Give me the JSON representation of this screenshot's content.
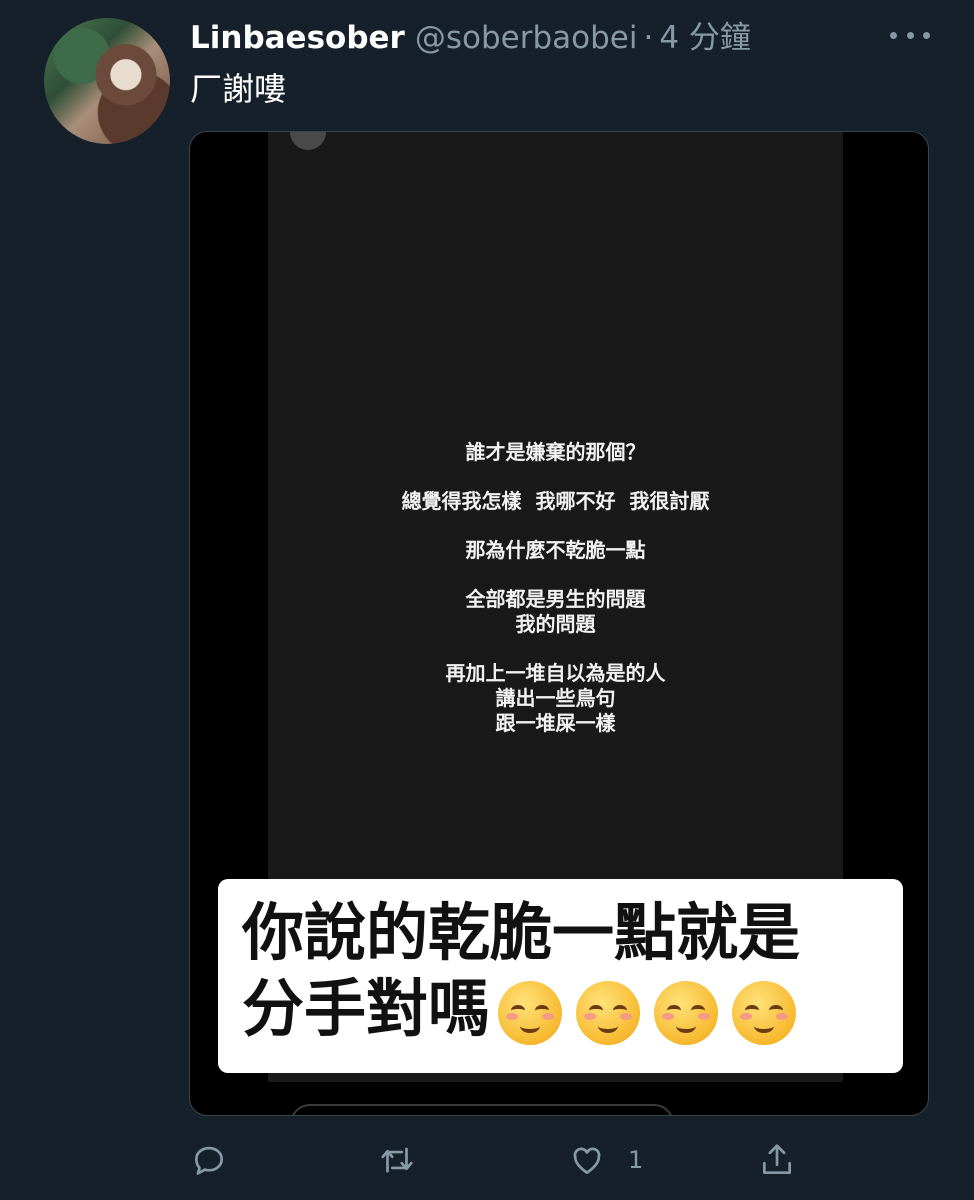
{
  "tweet": {
    "display_name": "Linbaesober",
    "handle": "@soberbaobei",
    "separator": "·",
    "time": "4 分鐘",
    "text": "厂謝嘍"
  },
  "media": {
    "story_lines": [
      "誰才是嫌棄的那個？",
      "",
      "總覺得我怎樣  我哪不好  我很討厭",
      "",
      "那為什麼不乾脆一點",
      "",
      "全部都是男生的問題",
      "我的問題",
      "",
      "再加上一堆自以為是的人",
      "講出一些鳥句",
      "跟一堆屎一樣"
    ],
    "caption_line1": "你說的乾脆一點就是",
    "caption_line2": "分手對嗎",
    "caption_emoji_count": 4,
    "caption_emoji": "smiling-face-icon"
  },
  "actions": {
    "reply_icon": "reply-icon",
    "retweet_icon": "retweet-icon",
    "like_icon": "like-icon",
    "like_count": "1",
    "share_icon": "share-icon"
  },
  "colors": {
    "background": "#15202b",
    "secondary_text": "#8899a6"
  }
}
